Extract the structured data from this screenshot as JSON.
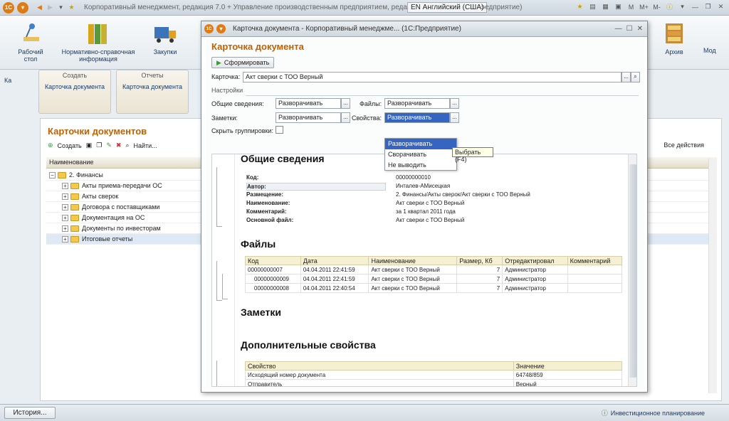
{
  "titlebar": {
    "title": "Корпоративный менеджмент, редакция 7.0 + Управление производственным предприятием, редакция 1.3",
    "lang": "EN Английский (США)",
    "lang_tail": "эедприятие)",
    "right_icons": [
      "M",
      "M+",
      "M-"
    ]
  },
  "mainbar": {
    "items": [
      {
        "label": "Рабочий стол"
      },
      {
        "label": "Нормативно-справочная информация"
      },
      {
        "label": "Закупки"
      },
      {
        "label": "Архив"
      },
      {
        "label": "Мод"
      }
    ]
  },
  "leftstrip": {
    "tab": "Ка"
  },
  "panels": [
    {
      "header": "Создать",
      "link": "Карточка документа"
    },
    {
      "header": "Отчеты",
      "link": "Карточка документа"
    }
  ],
  "list": {
    "title": "Карточки документов",
    "create": "Создать",
    "find": "Найти...",
    "all_actions": "Все действия",
    "column": "Наименование",
    "rows": [
      {
        "label": "2. Финансы",
        "level": 0,
        "exp": "−"
      },
      {
        "label": "Акты приема-передачи ОС",
        "level": 1,
        "exp": "+"
      },
      {
        "label": "Акты сверок",
        "level": 1,
        "exp": "+"
      },
      {
        "label": "Договора с поставщиками",
        "level": 1,
        "exp": "+"
      },
      {
        "label": "Документация на ОС",
        "level": 1,
        "exp": "+"
      },
      {
        "label": "Документы по инвесторам",
        "level": 1,
        "exp": "+"
      },
      {
        "label": "Итоговые отчеты",
        "level": 1,
        "exp": "+"
      }
    ]
  },
  "statusbar": {
    "history": "История...",
    "right": "Инвестиционное планирование"
  },
  "modal": {
    "title": "Карточка документа - Корпоративный менеджме...  (1С:Предприятие)",
    "heading": "Карточка документа",
    "form_button": "Сформировать",
    "card_label": "Карточка:",
    "card_value": "Акт сверки с ТОО Верный",
    "settings": "Настройки",
    "general_label": "Общие сведения:",
    "general_value": "Разворачивать",
    "files_label": "Файлы:",
    "files_value": "Разворачивать",
    "notes_label": "Заметки:",
    "notes_value": "Разворачивать",
    "props_label": "Свойства:",
    "props_value": "Разворачивать",
    "hide_groups": "Скрыть группировки:",
    "dropdown": [
      "Разворачивать",
      "Сворачивать",
      "Не выводить"
    ],
    "tooltip": "Выбрать (F4)"
  },
  "report": {
    "general_title": "Общие сведения",
    "general": [
      {
        "k": "Код:",
        "v": "00000000010"
      },
      {
        "k": "Автор:",
        "v": "Инталев-АМисецкая"
      },
      {
        "k": "Размещение:",
        "v": "2. Финансы/Акты сверок/Акт сверки с ТОО Верный"
      },
      {
        "k": "Наименование:",
        "v": "Акт сверки с ТОО Верный"
      },
      {
        "k": "Комментарий:",
        "v": "за 1 квартал 2011 года"
      },
      {
        "k": "Основной файл:",
        "v": "Акт сверки с ТОО Верный"
      }
    ],
    "files_title": "Файлы",
    "files_head": [
      "Код",
      "Дата",
      "Наименование",
      "Размер, Кб",
      "Отредактировал",
      "Комментарий"
    ],
    "files_rows": [
      [
        "00000000007",
        "04.04.2011 22:41:59",
        "Акт сверки с ТОО Верный",
        "7",
        "Администратор",
        ""
      ],
      [
        "00000000009",
        "04.04.2011 22:41:59",
        "Акт сверки с ТОО Верный",
        "7",
        "Администратор",
        ""
      ],
      [
        "00000000008",
        "04.04.2011 22:40:54",
        "Акт сверки с ТОО Верный",
        "7",
        "Администратор",
        ""
      ]
    ],
    "notes_title": "Заметки",
    "props_title": "Дополнительные свойства",
    "props_head": [
      "Свойство",
      "Значение"
    ],
    "props_rows": [
      [
        "Исходящий номер документа",
        "64748/859"
      ],
      [
        "Отправитель",
        "Верный"
      ]
    ]
  }
}
